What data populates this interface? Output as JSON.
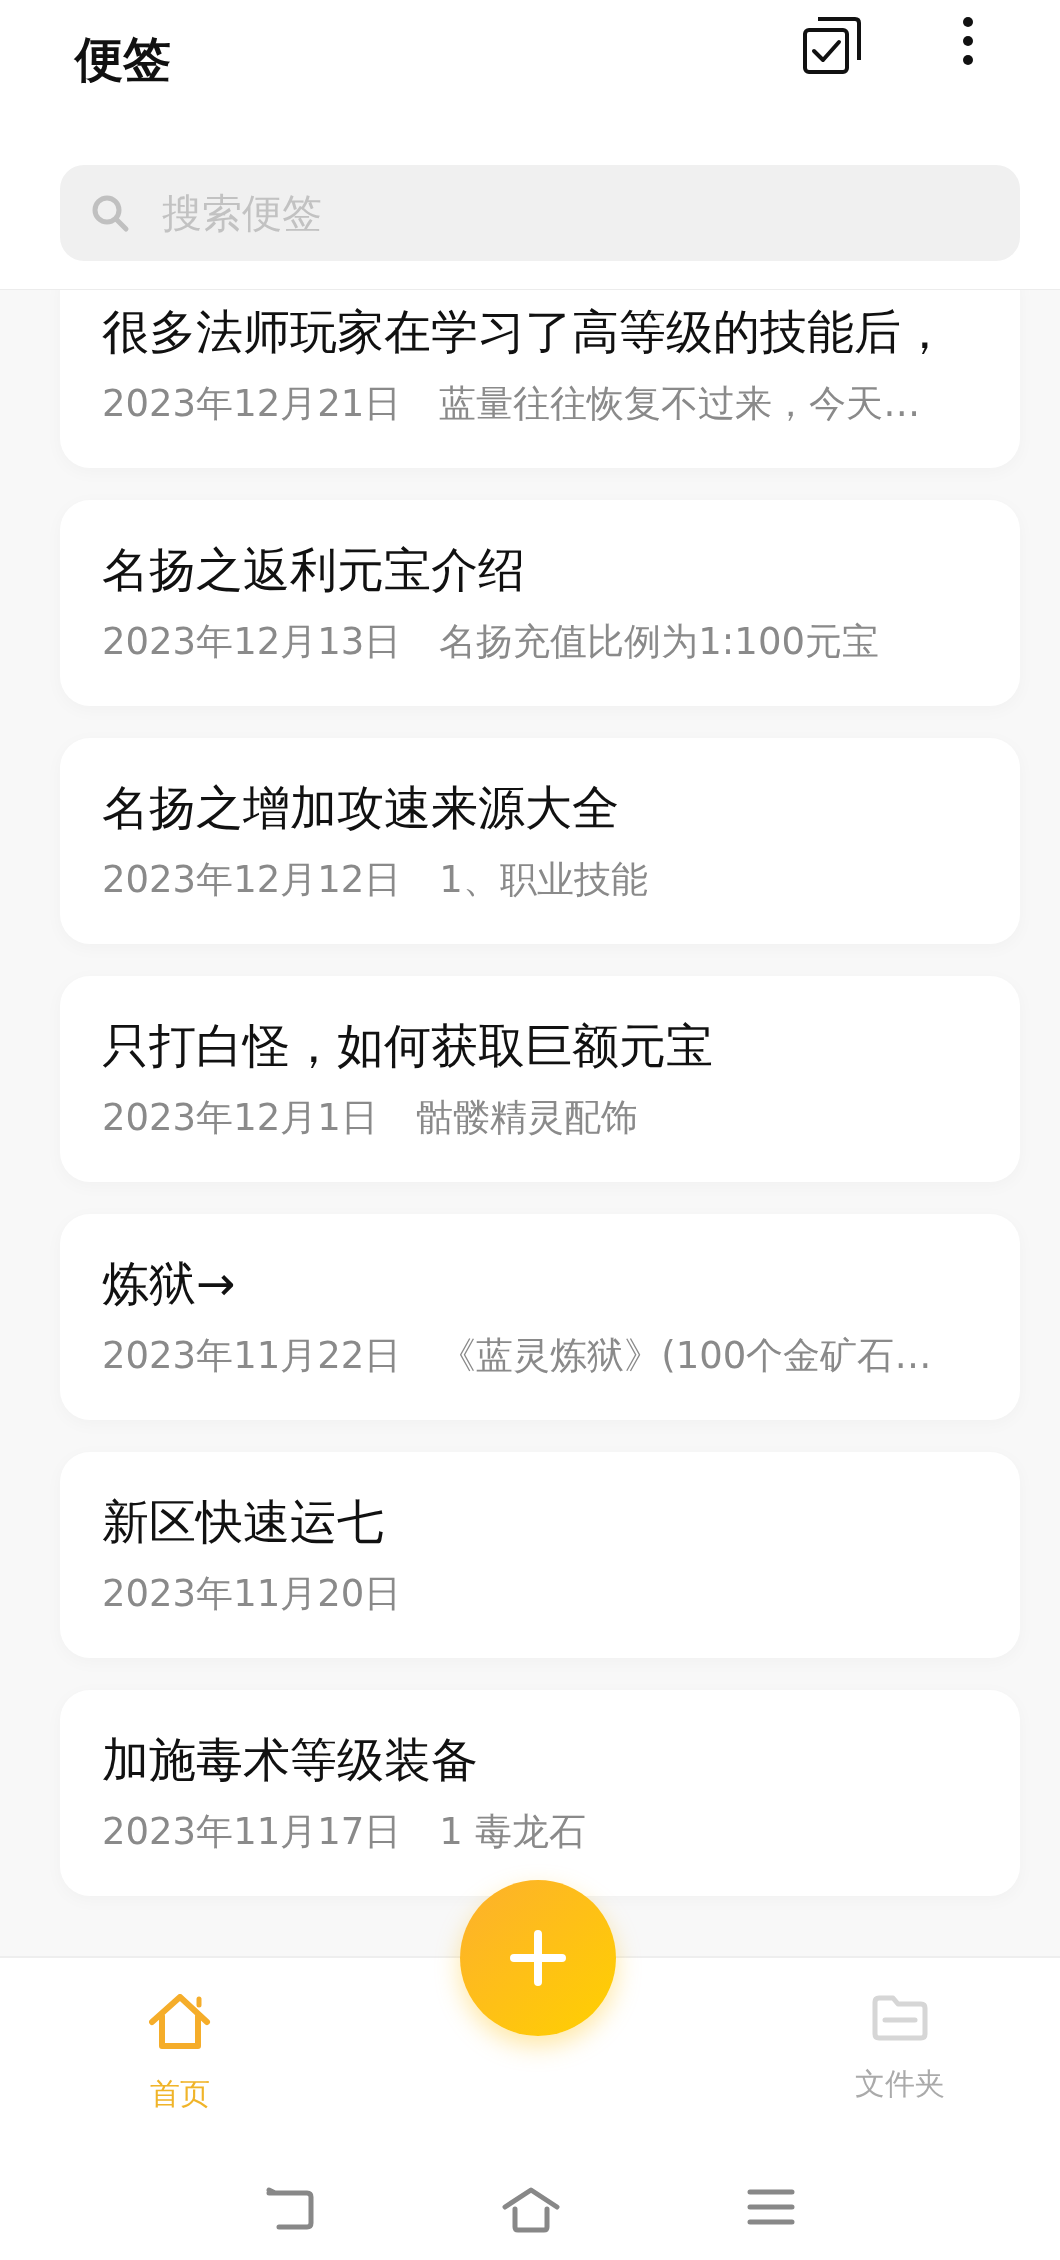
{
  "header": {
    "title": "便签"
  },
  "search": {
    "placeholder": "搜索便签"
  },
  "notes": [
    {
      "title": "很多法师玩家在学习了高等级的技能后，",
      "date": "2023年12月21日",
      "snippet": "蓝量往往恢复不过来，今天…"
    },
    {
      "title": "名扬之返利元宝介绍",
      "date": "2023年12月13日",
      "snippet": "名扬充值比例为1:100元宝"
    },
    {
      "title": "名扬之增加攻速来源大全",
      "date": "2023年12月12日",
      "snippet": "1、职业技能"
    },
    {
      "title": "只打白怪，如何获取巨额元宝",
      "date": "2023年12月1日",
      "snippet": "骷髅精灵配饰"
    },
    {
      "title": "炼狱→",
      "date": "2023年11月22日",
      "snippet": "《蓝灵炼狱》(100个金矿石…"
    },
    {
      "title": "新区快速运七",
      "date": "2023年11月20日"
    },
    {
      "title": "加施毒术等级装备",
      "date": "2023年11月17日",
      "snippet": "1 毒龙石"
    }
  ],
  "tabs": [
    {
      "kind": "home",
      "label": "首页",
      "selected": true
    },
    {
      "kind": "folder",
      "label": "文件夹",
      "selected": false
    }
  ]
}
